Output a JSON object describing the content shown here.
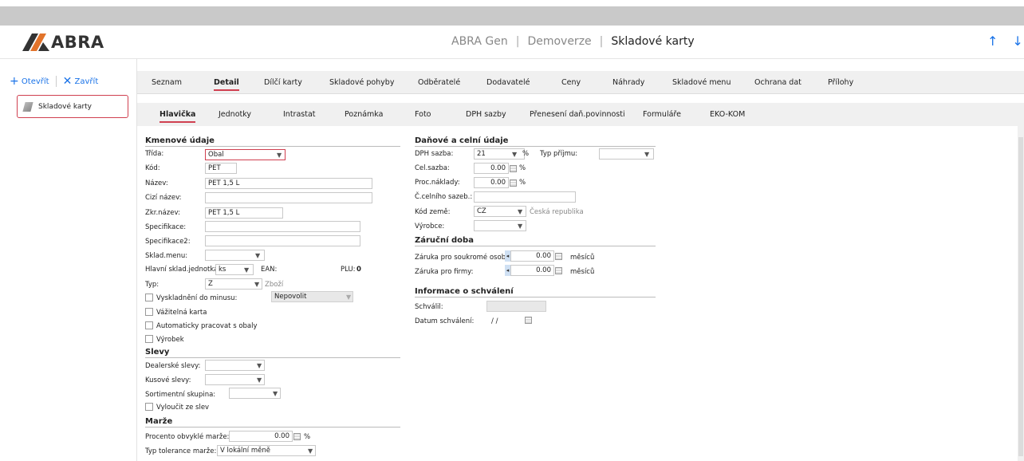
{
  "app": {
    "logo": "ABRA",
    "crumb1": "ABRA Gen",
    "crumb2": "Demoverze",
    "crumb3": "Skladové karty",
    "sep": "|"
  },
  "left": {
    "open": "Otevřít",
    "close": "Zavřít",
    "tab": "Skladové karty"
  },
  "tabs1": [
    "Seznam",
    "Detail",
    "Dílčí karty",
    "Skladové pohyby",
    "Odběratelé",
    "Dodavatelé",
    "Ceny",
    "Náhrady",
    "Skladové menu",
    "Ochrana dat",
    "Přílohy"
  ],
  "tabs2": [
    "Hlavička",
    "Jednotky",
    "Intrastat",
    "Poznámka",
    "Foto",
    "DPH sazby",
    "Přenesení daň.povinnosti",
    "Formuláře",
    "EKO-KOM"
  ],
  "kmen": {
    "title": "Kmenové údaje",
    "trida_l": "Třída:",
    "trida_v": "Obal",
    "kod_l": "Kód:",
    "kod_v": "PET",
    "nazev_l": "Název:",
    "nazev_v": "PET 1,5 L",
    "cizi_l": "Cizí název:",
    "zkr_l": "Zkr.název:",
    "zkr_v": "PET 1,5 L",
    "spec_l": "Specifikace:",
    "spec2_l": "Specifikace2:",
    "sklmenu_l": "Sklad.menu:",
    "hlj_l": "Hlavní sklad.jednotka:",
    "hlj_v": "ks",
    "ean_l": "EAN:",
    "plu_l": "PLU:",
    "plu_v": "0",
    "typ_l": "Typ:",
    "typ_v": "Z",
    "typ_hint": "Zboží",
    "vysk_l": "Vyskladnění do minusu:",
    "vysk_v": "Nepovolit",
    "vaz_l": "Vážitelná karta",
    "auto_l": "Automaticky pracovat s obaly",
    "vyr_l": "Výrobek"
  },
  "slevy": {
    "title": "Slevy",
    "deal_l": "Dealerské slevy:",
    "kus_l": "Kusové slevy:",
    "sort_l": "Sortimentní skupina:",
    "vyl_l": "Vyloučit ze slev"
  },
  "marze": {
    "title": "Marže",
    "proc_l": "Procento obvyklé marže:",
    "proc_v": "0.00",
    "pct": "%",
    "tol_l": "Typ tolerance marže:",
    "tol_v": "V lokální měně"
  },
  "dan": {
    "title": "Daňové a celní údaje",
    "dph_l": "DPH sazba:",
    "dph_v": "21",
    "pct": "%",
    "typp_l": "Typ příjmu:",
    "cel_l": "Cel.sazba:",
    "cel_v": "0.00",
    "proc_l": "Proc.náklady:",
    "proc_v": "0.00",
    "csaz_l": "Č.celního sazeb.:",
    "zeme_l": "Kód země:",
    "zeme_v": "CZ",
    "zeme_hint": "Česká republika",
    "vyrobce_l": "Výrobce:"
  },
  "zaruka": {
    "title": "Záruční doba",
    "sou_l": "Záruka pro soukromé osoby:",
    "sou_v": "0.00",
    "unit": "měsíců",
    "firm_l": "Záruka pro firmy:",
    "firm_v": "0.00"
  },
  "schval": {
    "title": "Informace o schválení",
    "schv_l": "Schválil:",
    "dat_l": "Datum schválení:",
    "dat_v": "/ /"
  },
  "colors": {
    "accent": "#d04050",
    "blue": "#1a73e8"
  }
}
